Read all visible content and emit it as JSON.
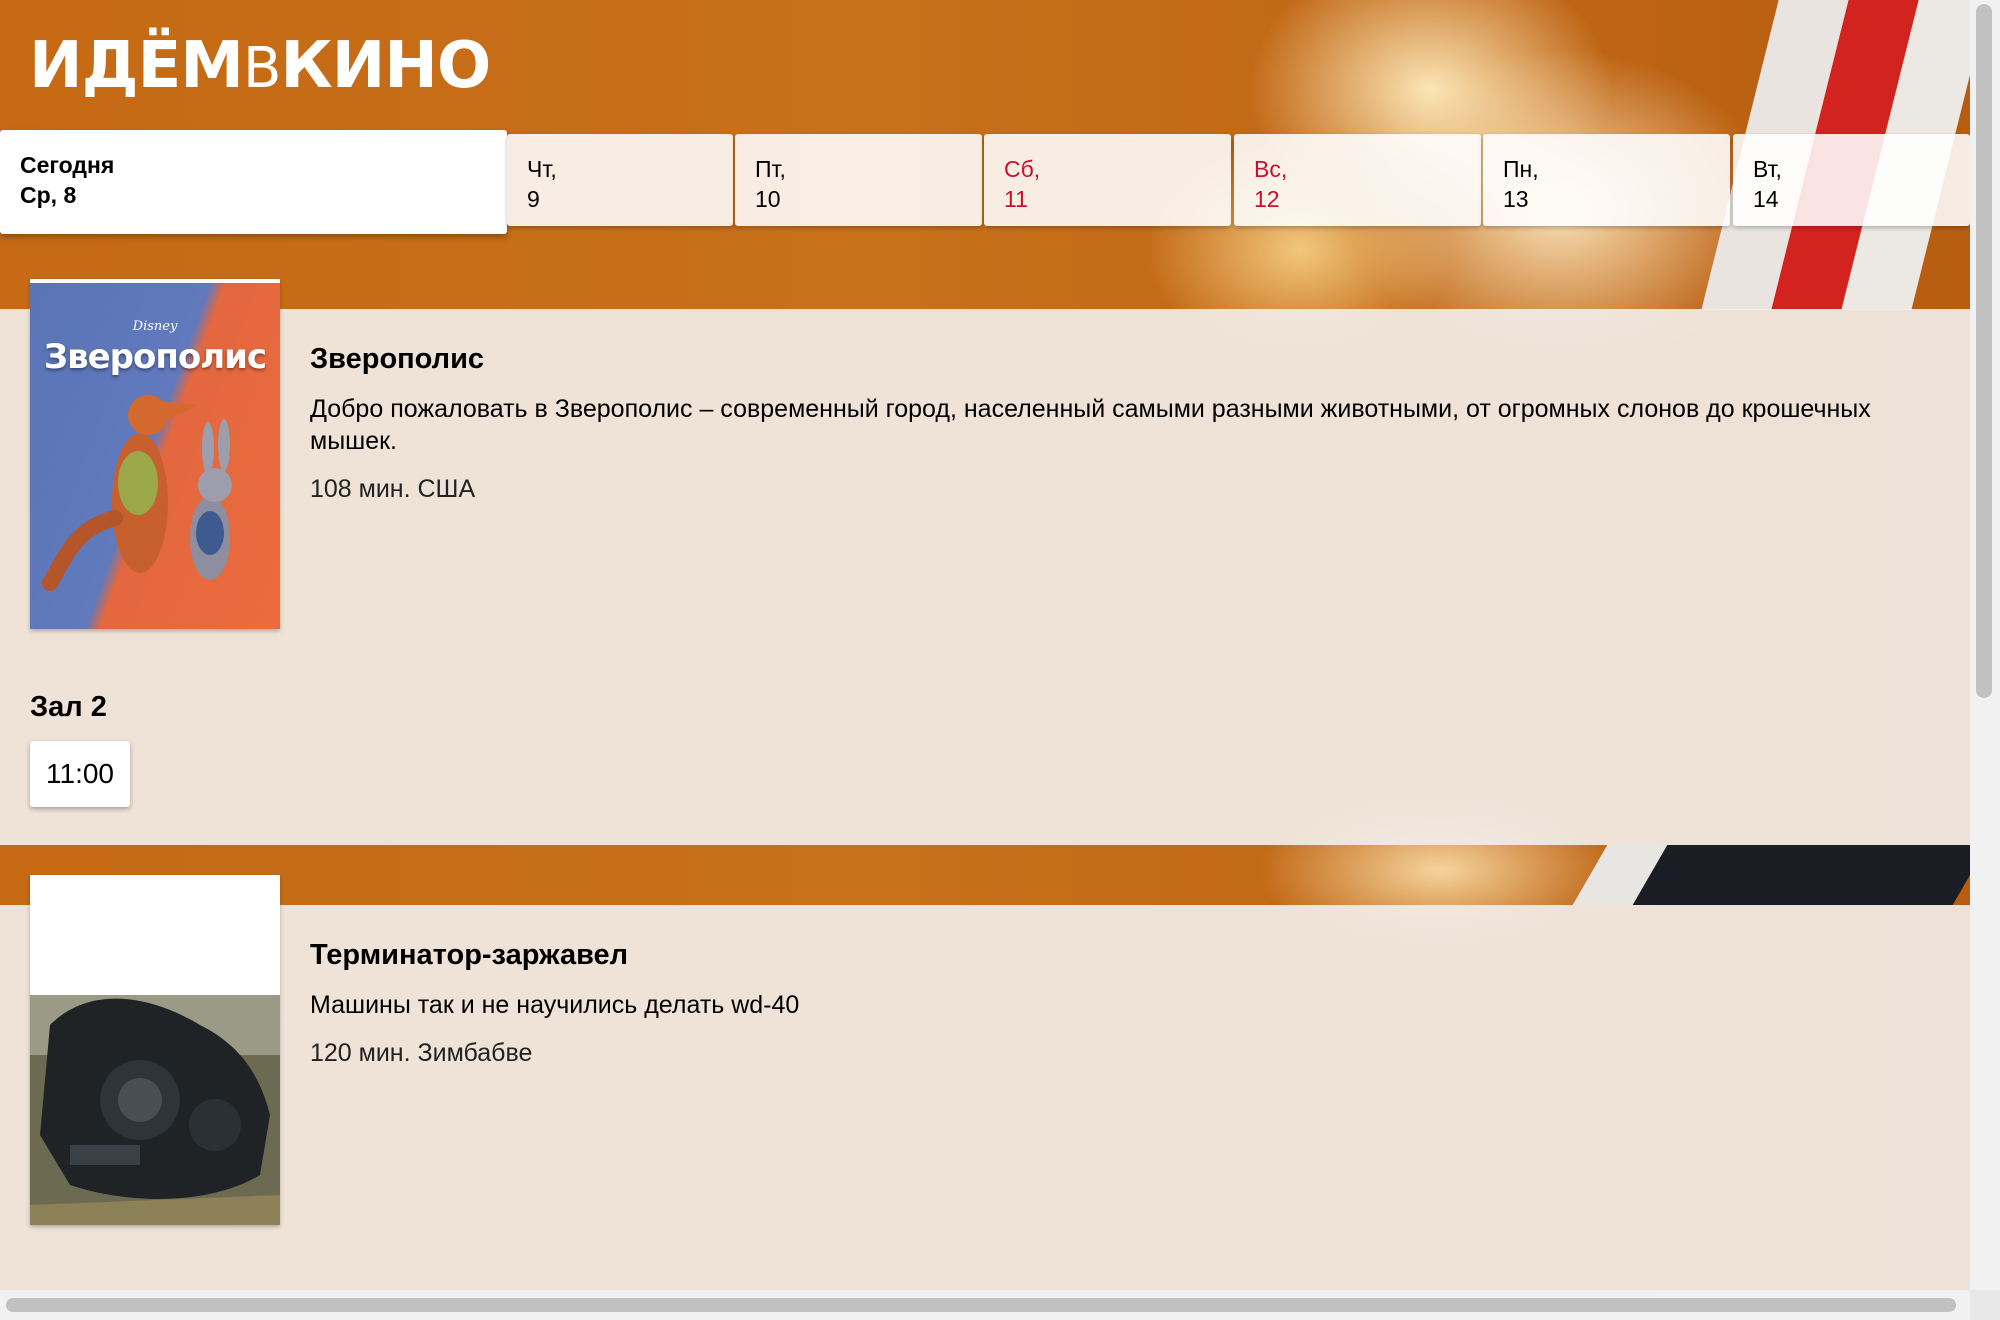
{
  "header": {
    "logo_part1": "ИДЁМ",
    "logo_part2": "В",
    "logo_part3": "КИНО"
  },
  "date_nav": {
    "today": {
      "label": "Сегодня",
      "date": "Ср, 8"
    },
    "days": [
      {
        "weekday": "Чт,",
        "day": "9",
        "weekend": false
      },
      {
        "weekday": "Пт,",
        "day": "10",
        "weekend": false
      },
      {
        "weekday": "Сб,",
        "day": "11",
        "weekend": true
      },
      {
        "weekday": "Вс,",
        "day": "12",
        "weekend": true
      },
      {
        "weekday": "Пн,",
        "day": "13",
        "weekend": false
      },
      {
        "weekday": "Вт,",
        "day": "14",
        "weekend": false
      }
    ]
  },
  "movies": [
    {
      "title": "Зверополис",
      "description": "Добро пожаловать в Зверополис – современный город, населенный самыми разными животными, от огромных слонов до крошечных мышек.",
      "meta": "108 мин. США",
      "poster_title": "Зверополис",
      "poster_brand": "Disney",
      "hall": "Зал 2",
      "seances": [
        "11:00"
      ]
    },
    {
      "title": "Терминатор-заржавел",
      "description": "Машины так и не научились делать wd-40",
      "meta": "120 мин. Зимбабве"
    }
  ],
  "colors": {
    "accent_orange": "#c96a12",
    "weekend_red": "#c8102e"
  }
}
